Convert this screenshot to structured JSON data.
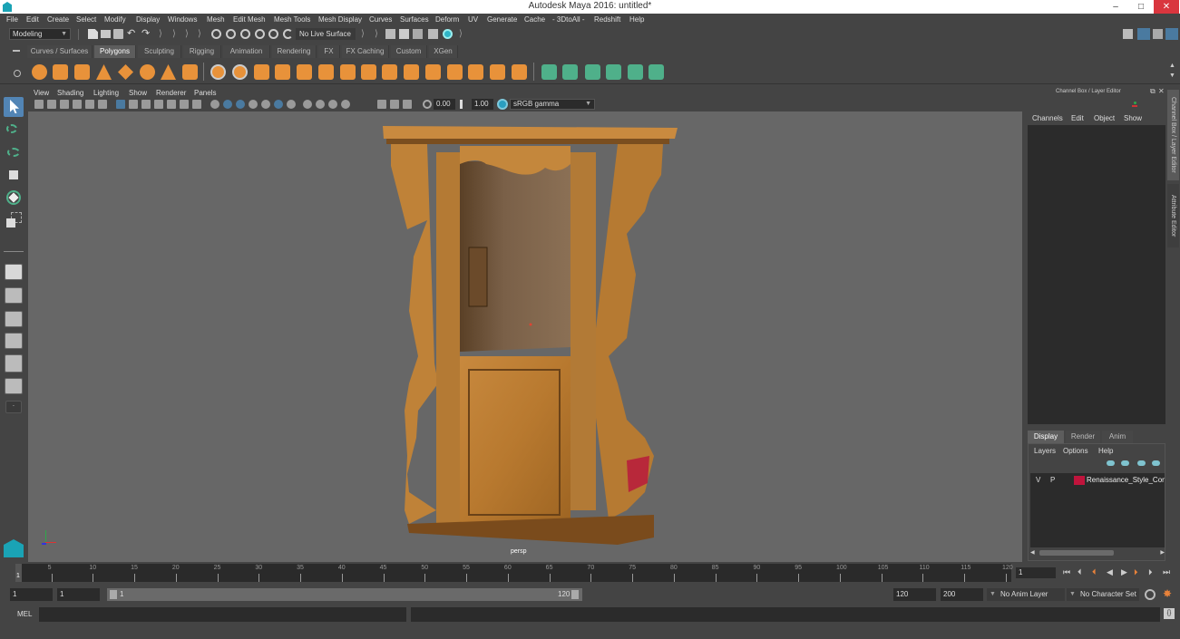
{
  "window": {
    "title": "Autodesk Maya 2016: untitled*",
    "minimize": "–",
    "maximize": "□",
    "close": "✕",
    "close_color": "#d9363e"
  },
  "menubar": [
    "File",
    "Edit",
    "Create",
    "Select",
    "Modify",
    "Display",
    "Windows",
    "Mesh",
    "Edit Mesh",
    "Mesh Tools",
    "Mesh Display",
    "Curves",
    "Surfaces",
    "Deform",
    "UV",
    "Generate",
    "Cache",
    "- 3DtoAll -",
    "Redshift",
    "Help"
  ],
  "statusline": {
    "mode": "Modeling",
    "live_surface": "No Live Surface"
  },
  "shelf": {
    "tabs": [
      "Curves / Surfaces",
      "Polygons",
      "Sculpting",
      "Rigging",
      "Animation",
      "Rendering",
      "FX",
      "FX Caching",
      "Custom",
      "XGen"
    ],
    "active_tab": "Polygons",
    "icons": [
      "poly-sphere-icon",
      "poly-cube-icon",
      "poly-cylinder-icon",
      "poly-cone-icon",
      "poly-plane-icon",
      "poly-torus-icon",
      "poly-pyramid-icon",
      "poly-pipe-icon",
      "combine-icon",
      "separate-icon",
      "mirror-icon",
      "smooth-icon",
      "boolean-icon",
      "extract-icon",
      "bevel-icon",
      "bridge-icon",
      "extrude-icon",
      "append-icon",
      "multi-cut-icon",
      "target-weld-icon",
      "merge-icon",
      "collapse-icon",
      "planar-uv-icon",
      "cylindrical-uv-icon",
      "spherical-uv-icon",
      "automatic-uv-icon",
      "unfold-uv-icon",
      "uv-editor-icon",
      "cut-uv-icon"
    ],
    "accent_orange": "#e8923a",
    "accent_green": "#4fb08a"
  },
  "viewport": {
    "menu": [
      "View",
      "Shading",
      "Lighting",
      "Show",
      "Renderer",
      "Panels"
    ],
    "exposure": "0.00",
    "gamma": "1.00",
    "color_space": "sRGB gamma",
    "camera_label": "persp",
    "background": "#676767"
  },
  "channelbox": {
    "header": "Channel Box / Layer Editor",
    "menu": [
      "Channels",
      "Edit",
      "Object",
      "Show"
    ]
  },
  "layer_editor": {
    "tabs": [
      "Display",
      "Render",
      "Anim"
    ],
    "active_tab": "Display",
    "menu": [
      "Layers",
      "Options",
      "Help"
    ],
    "layers": [
      {
        "visible": "V",
        "playback": "P",
        "color": "#c0143c",
        "name": "Renaissance_Style_Confe"
      }
    ]
  },
  "side_tabs": [
    "Channel Box / Layer Editor",
    "Attribute Editor"
  ],
  "timeline": {
    "start_frame_marker": "1",
    "ticks": [
      5,
      10,
      15,
      20,
      25,
      30,
      35,
      40,
      45,
      50,
      55,
      60,
      65,
      70,
      75,
      80,
      85,
      90,
      95,
      100,
      105,
      110,
      115,
      120
    ],
    "min": 1,
    "max": 120,
    "current_frame": "1"
  },
  "range": {
    "start_time": "1",
    "playback_start": "1",
    "slider_start": "1",
    "slider_end": "120",
    "playback_end": "120",
    "end_time": "200",
    "anim_layer": "No Anim Layer",
    "character_set": "No Character Set"
  },
  "playback": [
    "go-to-start-icon",
    "step-back-key-icon",
    "step-back-frame-icon",
    "play-backward-icon",
    "play-forward-icon",
    "step-forward-frame-icon",
    "step-forward-key-icon",
    "go-to-end-icon"
  ],
  "cmdline": {
    "label": "MEL",
    "value": "",
    "result": ""
  }
}
